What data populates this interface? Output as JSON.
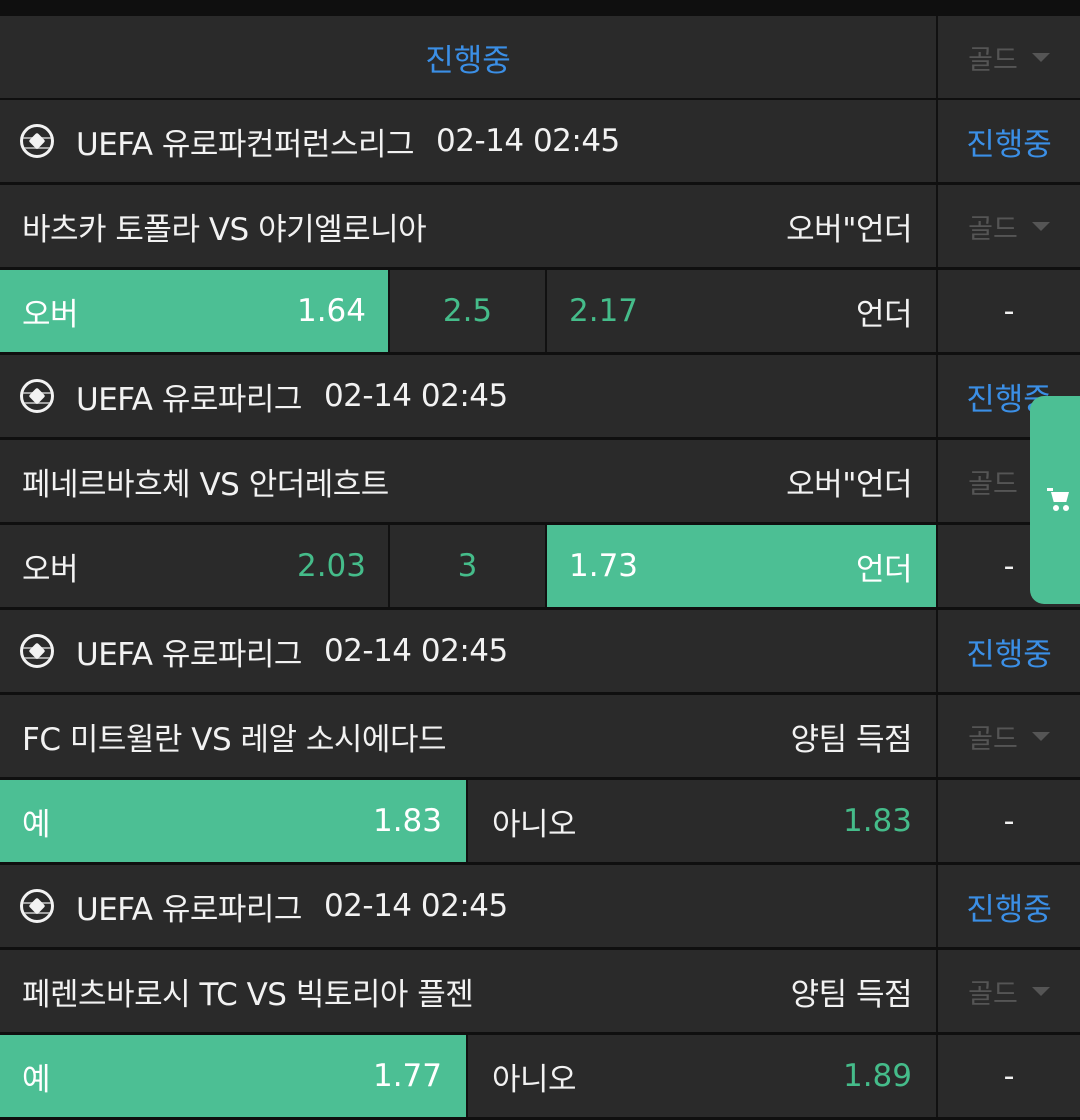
{
  "top_header": {
    "status": "진행중",
    "gold": "골드"
  },
  "matches": [
    {
      "league": "UEFA 유로파컨퍼런스리그",
      "time": "02-14 02:45",
      "status": "진행중",
      "teams": "바츠카 토폴라 VS 야기엘로니아",
      "market": "오버\"언더",
      "gold": "골드",
      "type": "ou",
      "over_label": "오버",
      "over_odds": "1.64",
      "line": "2.5",
      "under_odds": "2.17",
      "under_label": "언더",
      "selected": "over",
      "extra": "-"
    },
    {
      "league": "UEFA 유로파리그",
      "time": "02-14 02:45",
      "status": "진행중",
      "teams": "페네르바흐체 VS 안더레흐트",
      "market": "오버\"언더",
      "gold": "골드",
      "type": "ou",
      "over_label": "오버",
      "over_odds": "2.03",
      "line": "3",
      "under_odds": "1.73",
      "under_label": "언더",
      "selected": "under",
      "extra": "-"
    },
    {
      "league": "UEFA 유로파리그",
      "time": "02-14 02:45",
      "status": "진행중",
      "teams": "FC 미트윌란 VS 레알 소시에다드",
      "market": "양팀 득점",
      "gold": "골드",
      "type": "yn",
      "yes_label": "예",
      "yes_odds": "1.83",
      "no_label": "아니오",
      "no_odds": "1.83",
      "selected": "yes",
      "extra": "-"
    },
    {
      "league": "UEFA 유로파리그",
      "time": "02-14 02:45",
      "status": "진행중",
      "teams": "페렌츠바로시 TC VS 빅토리아 플젠",
      "market": "양팀 득점",
      "gold": "골드",
      "type": "yn",
      "yes_label": "예",
      "yes_odds": "1.77",
      "no_label": "아니오",
      "no_odds": "1.89",
      "selected": "yes",
      "extra": "-"
    }
  ],
  "colors": {
    "accent_green": "#4cbf94",
    "live_blue": "#3b8fe6",
    "row_bg": "#2a2a2a"
  }
}
